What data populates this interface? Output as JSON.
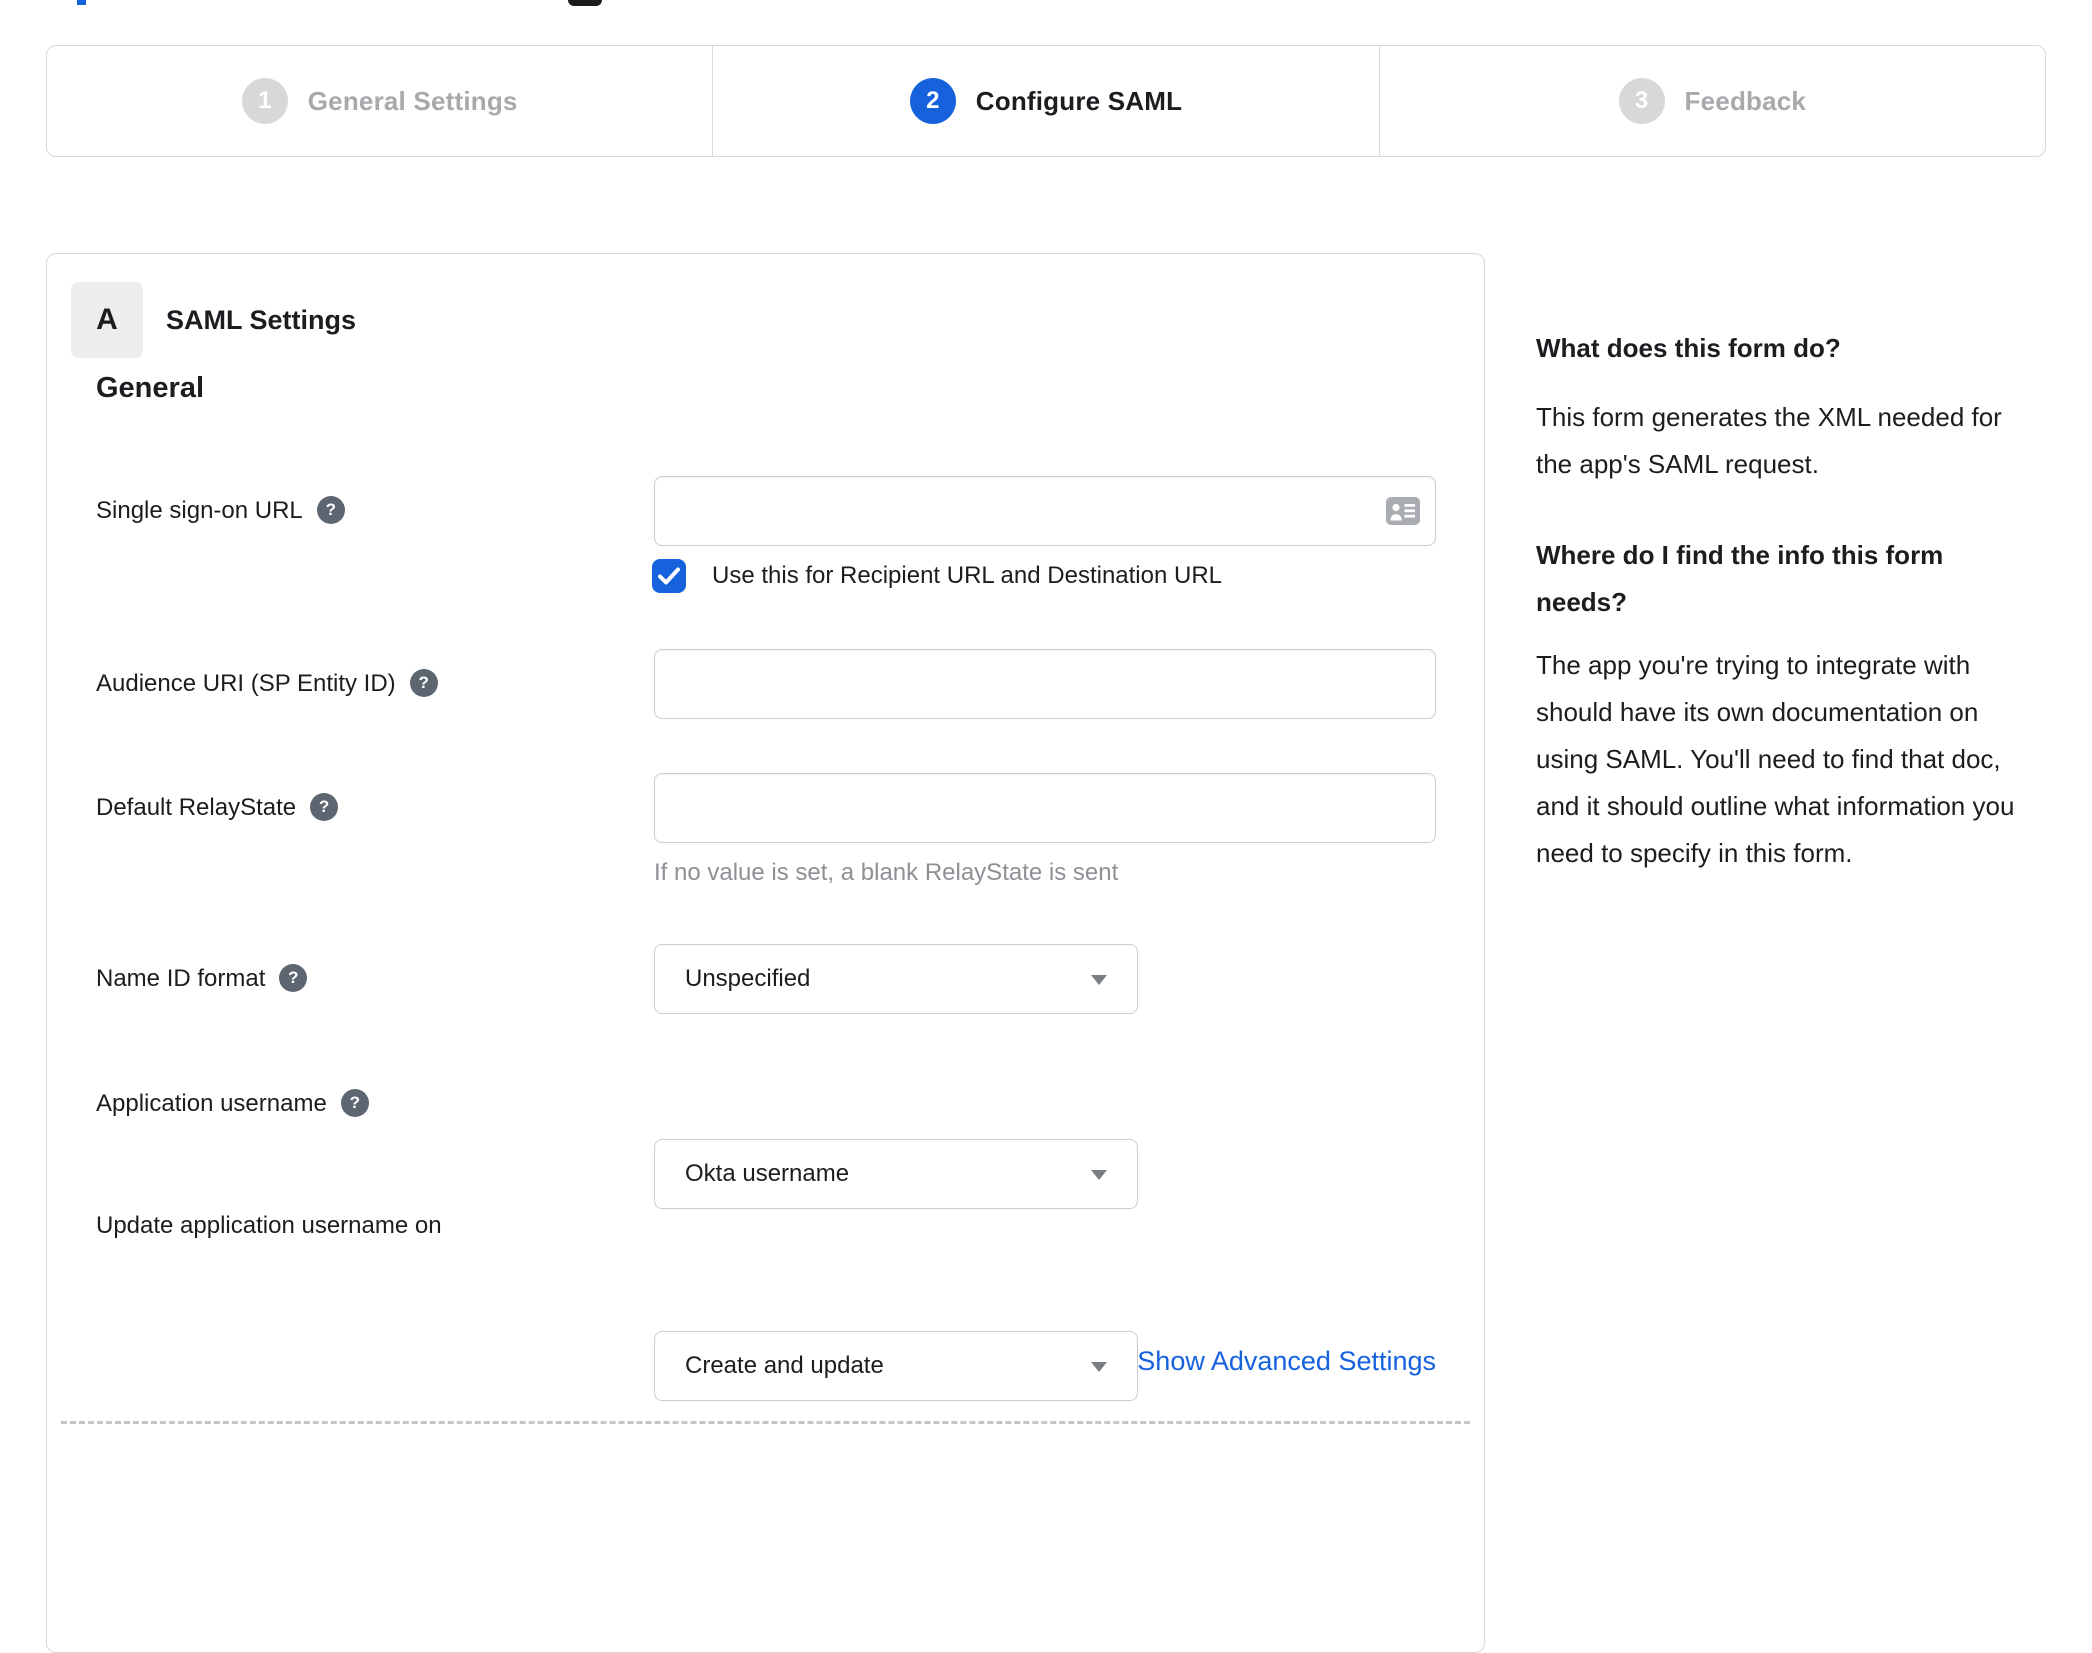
{
  "stepper": {
    "steps": [
      {
        "number": "1",
        "label": "General Settings"
      },
      {
        "number": "2",
        "label": "Configure SAML"
      },
      {
        "number": "3",
        "label": "Feedback"
      }
    ]
  },
  "panel": {
    "badge": "A",
    "title": "SAML Settings",
    "section_heading": "General",
    "help_glyph": "?",
    "fields": {
      "sso": {
        "label": "Single sign-on URL",
        "value": "",
        "checkbox_label": "Use this for Recipient URL and Destination URL",
        "checkbox_checked": true
      },
      "audience": {
        "label": "Audience URI (SP Entity ID)",
        "value": ""
      },
      "relay": {
        "label": "Default RelayState",
        "value": "",
        "hint": "If no value is set, a blank RelayState is sent"
      },
      "name_id": {
        "label": "Name ID format",
        "value": "Unspecified"
      },
      "app_username": {
        "label": "Application username",
        "value": "Okta username"
      },
      "update_username": {
        "label": "Update application username on",
        "value": "Create and update"
      }
    },
    "advanced_link": "Show Advanced Settings"
  },
  "sidebar": {
    "sections": [
      {
        "heading": "What does this form do?",
        "body": "This form generates the XML needed for the app's SAML request."
      },
      {
        "heading": "Where do I find the info this form needs?",
        "body": "The app you're trying to integrate with should have its own documentation on using SAML. You'll need to find that doc, and it should outline what information you need to specify in this form."
      }
    ]
  },
  "colors": {
    "accent_blue": "#1662dd",
    "step_inactive_gray": "#d6d8da",
    "text_dark": "#1d1d21",
    "text_muted": "#a7a9ac",
    "hint_gray": "#8d9095"
  }
}
